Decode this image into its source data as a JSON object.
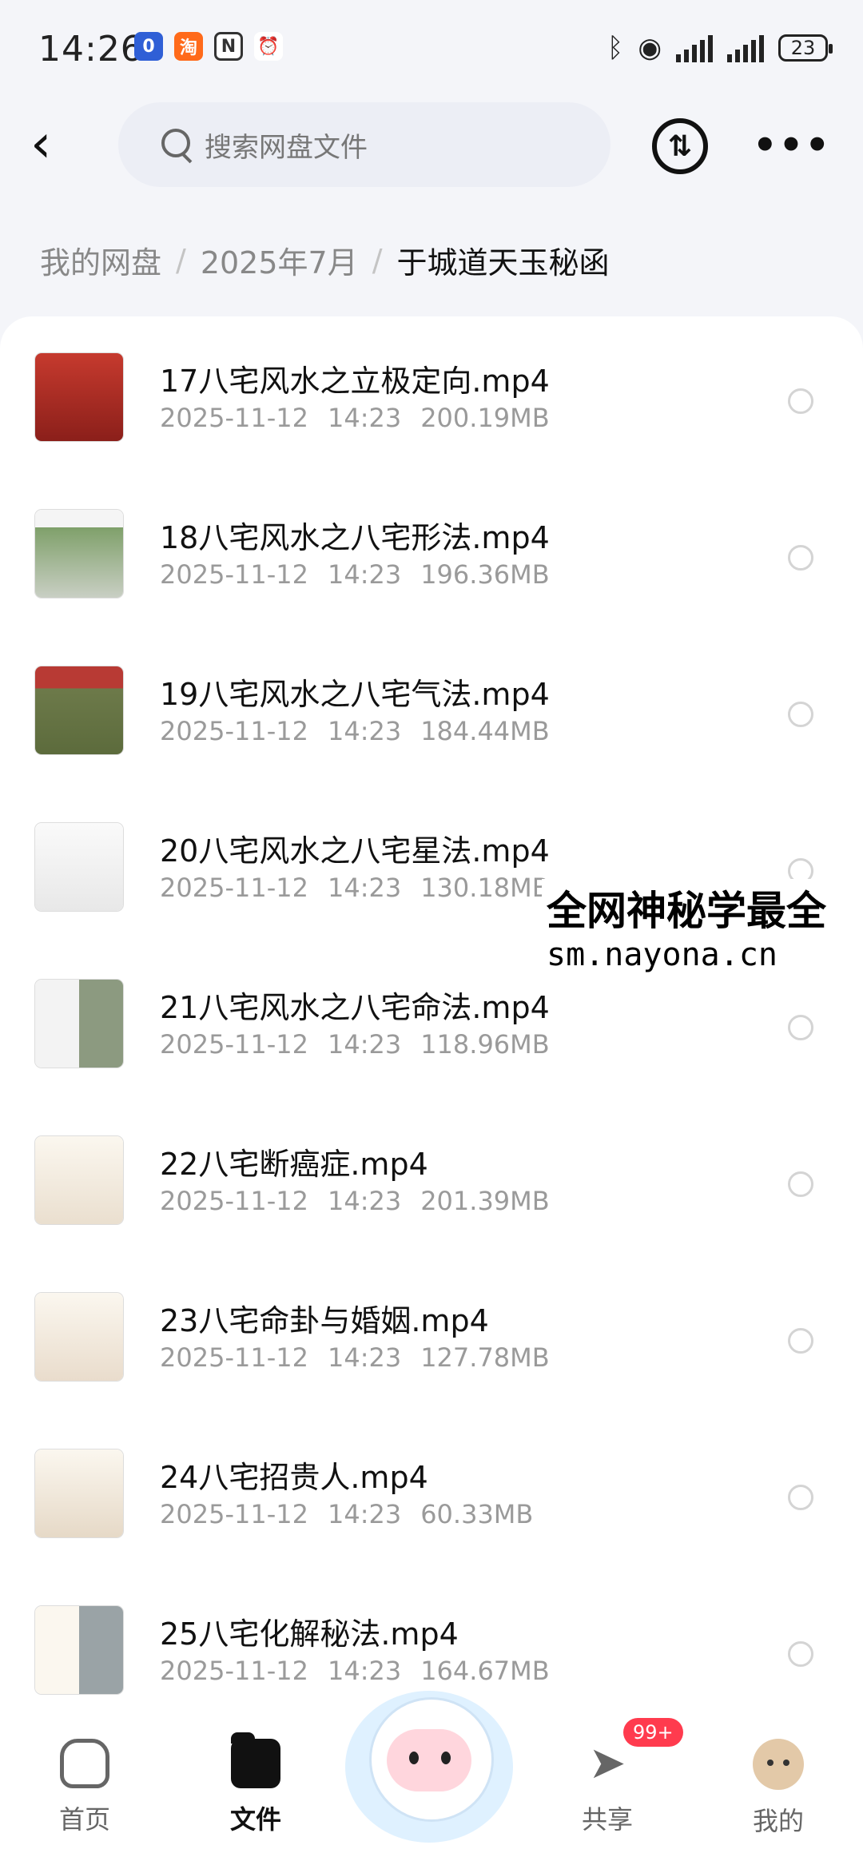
{
  "status_bar": {
    "time": "14:26",
    "apps": [
      {
        "icon": "calendar-app-icon",
        "label": "0",
        "color": "#2f5fd6"
      },
      {
        "icon": "taobao-app-icon",
        "label": "淘",
        "color": "#ff6a1a"
      },
      {
        "icon": "nfc-icon",
        "label": "N",
        "color": "#333333"
      },
      {
        "icon": "alarm-icon",
        "label": "⏰",
        "color": "#333333"
      }
    ],
    "battery": "23"
  },
  "header": {
    "search_placeholder": "搜索网盘文件"
  },
  "breadcrumb": {
    "items": [
      "我的网盘",
      "2025年7月"
    ],
    "current": "于城道天玉秘函"
  },
  "files": [
    {
      "name": "17八宅风水之立极定向.mp4",
      "date": "2025-11-12",
      "time": "14:23",
      "size": "200.19MB"
    },
    {
      "name": "18八宅风水之八宅形法.mp4",
      "date": "2025-11-12",
      "time": "14:23",
      "size": "196.36MB"
    },
    {
      "name": "19八宅风水之八宅气法.mp4",
      "date": "2025-11-12",
      "time": "14:23",
      "size": "184.44MB"
    },
    {
      "name": "20八宅风水之八宅星法.mp4",
      "date": "2025-11-12",
      "time": "14:23",
      "size": "130.18MB"
    },
    {
      "name": "21八宅风水之八宅命法.mp4",
      "date": "2025-11-12",
      "time": "14:23",
      "size": "118.96MB"
    },
    {
      "name": "22八宅断癌症.mp4",
      "date": "2025-11-12",
      "time": "14:23",
      "size": "201.39MB"
    },
    {
      "name": "23八宅命卦与婚姻.mp4",
      "date": "2025-11-12",
      "time": "14:23",
      "size": "127.78MB"
    },
    {
      "name": "24八宅招贵人.mp4",
      "date": "2025-11-12",
      "time": "14:23",
      "size": "60.33MB"
    },
    {
      "name": "25八宅化解秘法.mp4",
      "date": "2025-11-12",
      "time": "14:23",
      "size": "164.67MB"
    }
  ],
  "watermark": {
    "line1": "全网神秘学最全",
    "line2": "sm.nayona.cn"
  },
  "bottom_nav": {
    "home": "首页",
    "files": "文件",
    "share": "共享",
    "share_badge": "99+",
    "me": "我的"
  },
  "colors": {
    "background": "#f4f5f9",
    "badge": "#ff3b4e",
    "search_bg": "#eceef5"
  }
}
